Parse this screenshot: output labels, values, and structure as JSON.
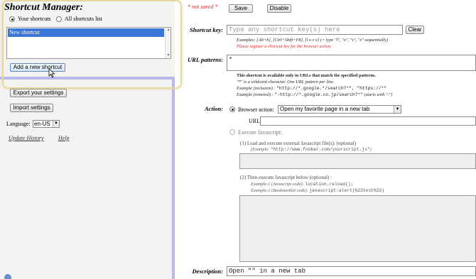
{
  "sidebar": {
    "title": "Shortcut Manager:",
    "radio_your_shortcuts": "Your shortcuts",
    "radio_all_shortcuts": "All shortcuts list",
    "selected_shortcut": "New shortcut",
    "add_button": "Add a new shortcut",
    "export_button": "Export your settings",
    "import_button": "Import settings",
    "language_label": "Language:",
    "language_value": "en-US",
    "update_history": "Update History",
    "help": "Help"
  },
  "main": {
    "not_saved": "* not saved *",
    "save_button": "Save",
    "disable_button": "Disable",
    "shortcut_key_label": "Shortcut key:",
    "shortcut_key_placeholder": "Type any shortcut key(s) here",
    "clear_button": "Clear",
    "shortcut_examples": "Examples:  [Alt+h], [Ctrl+Shift+F8], [l o v e] (= type \"l\", \"o\", \"v\", \"e\" sequentially)",
    "register_warning": "Please register a shortcut key for the browser action.",
    "url_patterns_label": "URL patterns:",
    "url_patterns_value": "*",
    "url_note_1": "This shortcut is available only in URLs that match the specified patterns.",
    "url_note_2": "\"*\" is a wildcard character.  One URL pattern per line.",
    "url_example_inclusion_label": "Example (inclusion) : ",
    "url_example_inclusion_code": "\"http://*.google.*/search?*\", \"https://*\"",
    "url_example_removal_label": "Example (removal) : ",
    "url_example_removal_code": "\"-http://*.google.co.jp/search?*\"",
    "url_example_removal_suffix": " (starts with \"-\")",
    "action_label": "Action:",
    "browser_action_label": "Browser action:",
    "browser_action_value": "Open my favorite page in a new tab",
    "url_label": "URL:",
    "execute_js_label": "Execute Javascript:",
    "load_external_label": "(1) Load and execute external Javascript file(s): (optional)",
    "load_external_example_label": "(Example: ",
    "load_external_example_code": "\"http://www.foobar.com/yourscript.js\"",
    "load_external_example_end": ")",
    "execute_below_label": "(2) Then execute Javascript below (optional) :",
    "example1_label": "Example-1 (Javascript code): ",
    "example1_code": "location.reload();",
    "example2_label": "Example-2 (Bookmarklet code): ",
    "example2_code": "javascript:alert(%22test%22)",
    "description_label": "Description:",
    "description_value": "Open \"\" in a new tab"
  },
  "colors": {
    "sidebar_bg": "#f3f3f3",
    "divider": "#b9b9ea",
    "selection": "#3875d7",
    "warning_red": "#e02020",
    "highlight_ring": "#e7d79c"
  }
}
